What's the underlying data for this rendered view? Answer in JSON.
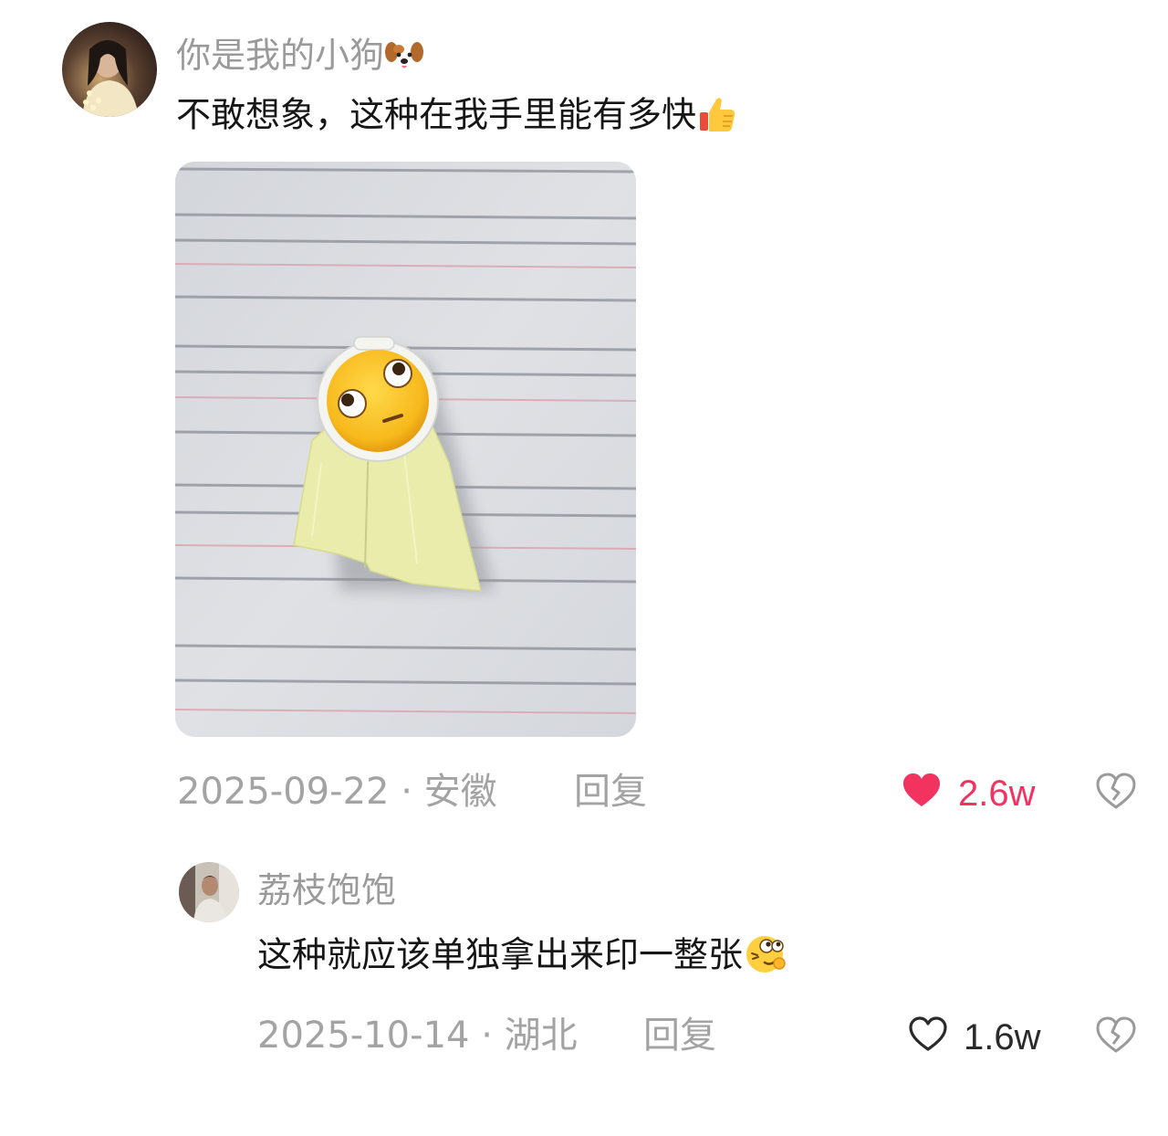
{
  "comment": {
    "username": "你是我的小狗",
    "username_emoji": "dog-face-emoji",
    "text": "不敢想象，这种在我手里能有多快",
    "text_emoji": "thumbs-up-emoji",
    "date": "2025-09-22",
    "separator": "·",
    "location": "安徽",
    "reply_label": "回复",
    "likes": "2.6w",
    "liked": true,
    "like_color": "#f2325f",
    "image_icon": "photo-rolling-eyes-sticker"
  },
  "reply": {
    "username": "荔枝饱饱",
    "text": "这种就应该单独拿出来印一整张",
    "text_emoji": "woozy-face-emoji",
    "date": "2025-10-14",
    "separator": "·",
    "location": "湖北",
    "reply_label": "回复",
    "likes": "1.6w",
    "liked": false
  },
  "icons": {
    "like": "heart-icon",
    "dislike": "broken-heart-icon"
  }
}
